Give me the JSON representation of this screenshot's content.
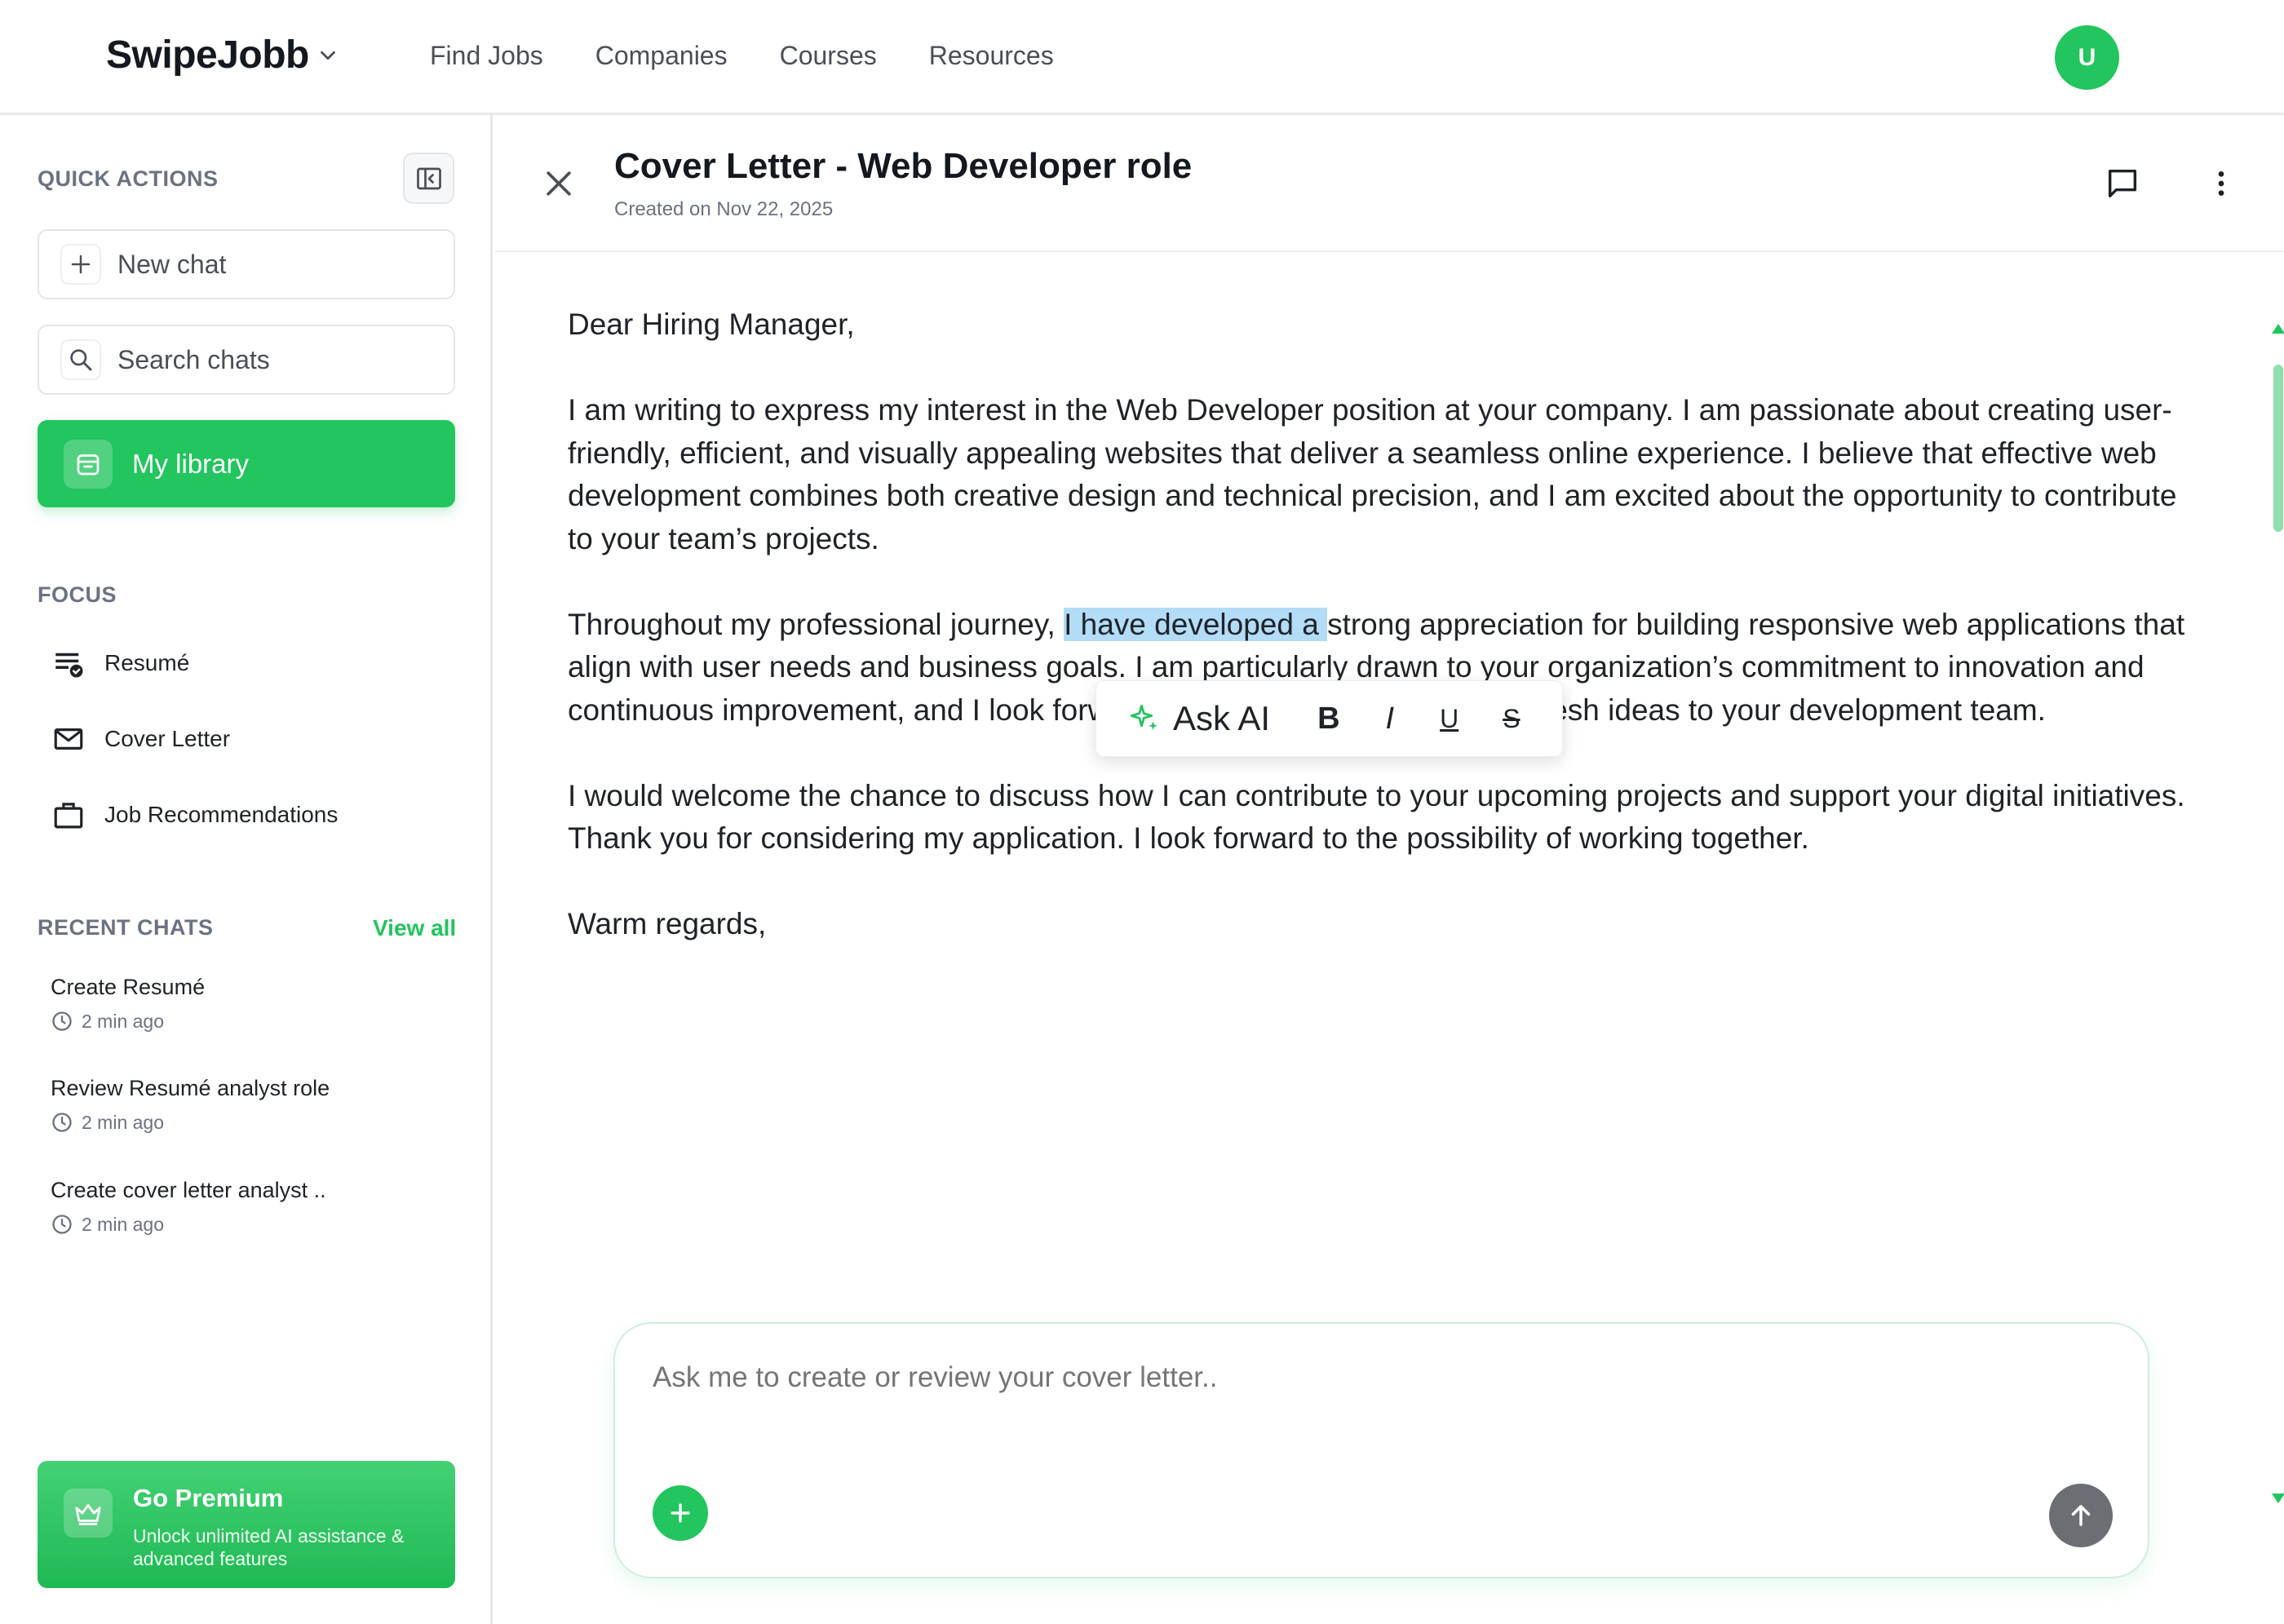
{
  "brand": {
    "name": "SwipeJobb"
  },
  "nav": {
    "links": [
      "Find Jobs",
      "Companies",
      "Courses",
      "Resources"
    ]
  },
  "user": {
    "avatar_initial": "U"
  },
  "sidebar": {
    "quick_actions_title": "QUICK ACTIONS",
    "new_chat": "New chat",
    "search_placeholder": "Search chats",
    "my_library": "My library",
    "focus_title": "FOCUS",
    "focus_items": [
      {
        "label": "Resumé",
        "icon": "resume-icon"
      },
      {
        "label": "Cover Letter",
        "icon": "mail-icon"
      },
      {
        "label": "Job Recommendations",
        "icon": "briefcase-icon"
      }
    ],
    "recent_title": "RECENT CHATS",
    "view_all": "View all",
    "recent_chats": [
      {
        "title": "Create Resumé",
        "time": "2 min ago"
      },
      {
        "title": "Review Resumé analyst role",
        "time": "2 min ago"
      },
      {
        "title": "Create cover letter analyst ..",
        "time": "2 min ago"
      }
    ],
    "premium": {
      "title": "Go Premium",
      "subtitle": "Unlock unlimited AI assistance & advanced features"
    }
  },
  "document": {
    "title": "Cover Letter - Web Developer role",
    "created": "Created on Nov 22, 2025",
    "greeting": "Dear Hiring Manager,",
    "p1": "I am writing to express my interest in the Web Developer position at your company. I am passionate about creating user-friendly, efficient, and visually appealing websites that deliver a seamless online experience. I believe that effective web development combines both creative design and technical precision, and I am excited about the opportunity to contribute to your team’s projects.",
    "p2_before": "Throughout my professional journey, ",
    "p2_selected": "I have developed a ",
    "p2_after": "strong appreciation for building responsive web applications that align with user needs and business goals. I am particularly drawn to your organization’s commitment to innovation and continuous improvement, and I look forward to bringing enthusiasm and fresh ideas to your development team.",
    "p3": "I would welcome the chance to discuss how I can contribute to your upcoming projects and support your digital initiatives. Thank you for considering my application. I look forward to the possibility of working together.",
    "closing": "Warm regards,"
  },
  "toolbar": {
    "ask_ai": "Ask AI",
    "bold": "B",
    "italic": "I",
    "underline": "U",
    "strike": "S"
  },
  "composer": {
    "placeholder": "Ask me to create or review your cover letter.."
  },
  "colors": {
    "accent": "#22c55e",
    "selection": "#b3dcf7",
    "send_button": "#6b6f74"
  }
}
